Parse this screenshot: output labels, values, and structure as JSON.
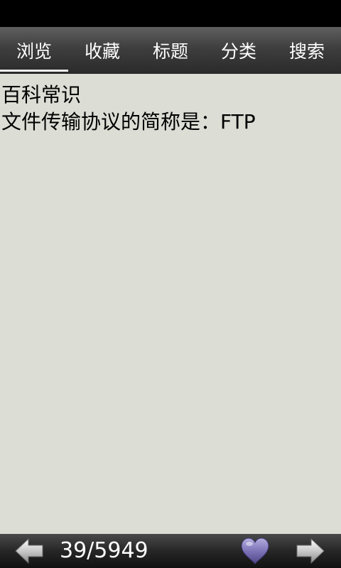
{
  "tabs": [
    {
      "label": "浏览",
      "active": true
    },
    {
      "label": "收藏",
      "active": false
    },
    {
      "label": "标题",
      "active": false
    },
    {
      "label": "分类",
      "active": false
    },
    {
      "label": "搜索",
      "active": false
    }
  ],
  "content": {
    "category": "百科常识",
    "question": "文件传输协议的简称是：FTP"
  },
  "footer": {
    "page_counter": "39/5949",
    "prev_icon": "arrow-left-icon",
    "next_icon": "arrow-right-icon",
    "favorite_icon": "heart-icon",
    "favorite_color": "#7d74b8"
  }
}
